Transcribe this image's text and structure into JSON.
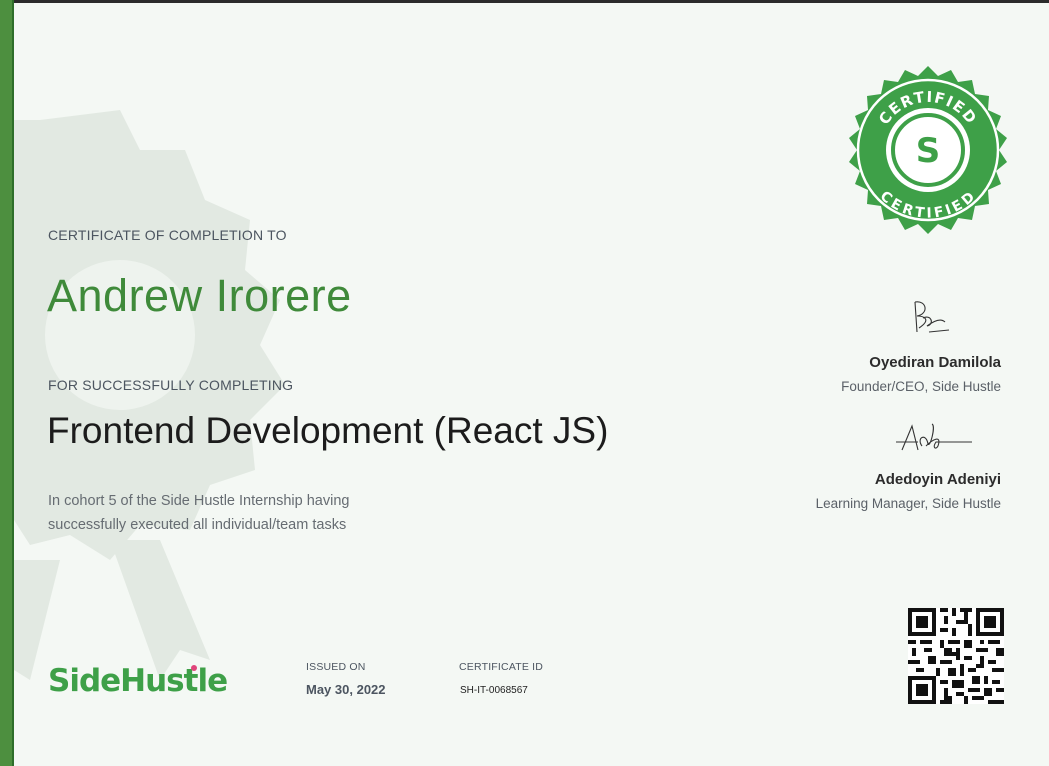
{
  "certificate": {
    "heading": "CERTIFICATE OF COMPLETION TO",
    "recipient": "Andrew Irorere",
    "completing_label": "FOR SUCCESSFULLY COMPLETING",
    "course": "Frontend Development (React JS)",
    "description_line1": "In cohort 5 of the Side Hustle Internship having",
    "description_line2": "successfully executed all individual/team tasks"
  },
  "seal": {
    "icon": "certified-seal-icon",
    "text_top": "CERTIFIED",
    "text_bottom": "CERTIFIED",
    "letter": "S"
  },
  "signatories": [
    {
      "name": "Oyediran Damilola",
      "role": "Founder/CEO, Side Hustle",
      "icon": "signature-icon"
    },
    {
      "name": "Adedoyin Adeniyi",
      "role": "Learning Manager, Side Hustle",
      "icon": "signature-icon"
    }
  ],
  "footer": {
    "logo_text_part1": "Side",
    "logo_text_part2": "Hustle",
    "issued_label": "ISSUED ON",
    "issued_date": "May 30, 2022",
    "id_label": "CERTIFICATE ID",
    "id_value": "SH-IT-0068567",
    "qr_icon": "qr-code-icon"
  },
  "colors": {
    "brand_green": "#3f8a3a",
    "seal_green": "#3ea048",
    "background": "#f4f8f4",
    "stripe": "#4d8f3f",
    "logo_dot": "#e0457b"
  }
}
